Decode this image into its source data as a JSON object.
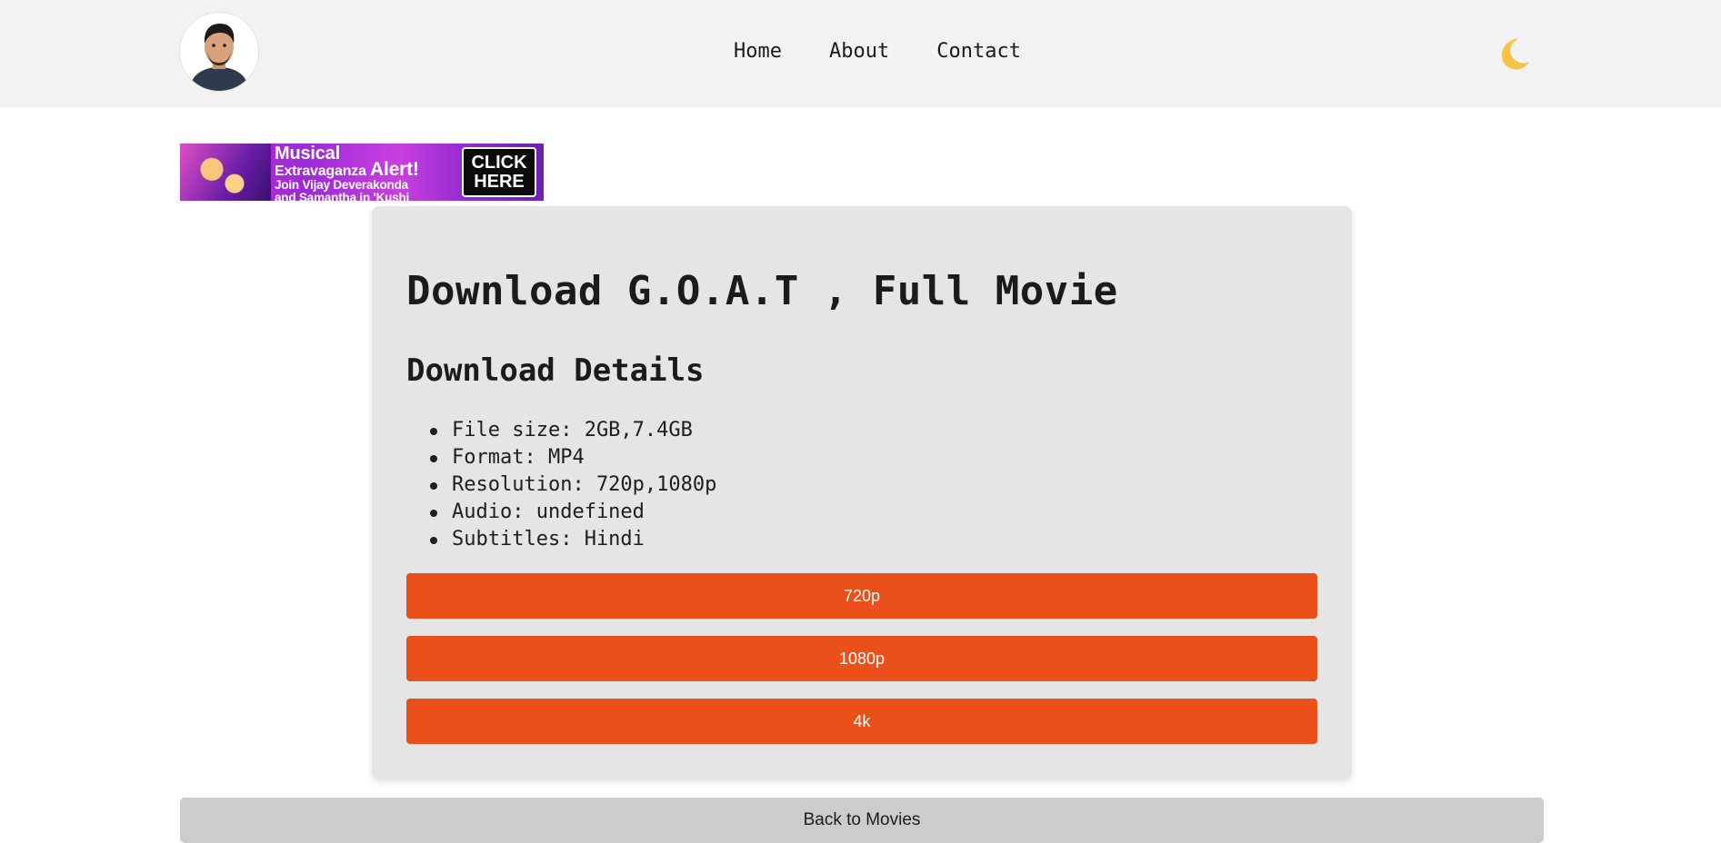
{
  "nav": {
    "links": [
      "Home",
      "About",
      "Contact"
    ],
    "theme_icon": "crescent-moon-icon"
  },
  "ad": {
    "line1a": "Musical",
    "line1b": "Extravaganza",
    "line1c": "Alert!",
    "line2": "Join Vijay Deverakonda",
    "line3": "and Samantha in 'Kushi",
    "cta_line1": "CLICK",
    "cta_line2": "HERE"
  },
  "main": {
    "title": "Download G.O.A.T , Full Movie",
    "section_title": "Download Details",
    "details": [
      "File size: 2GB,7.4GB",
      "Format: MP4",
      "Resolution: 720p,1080p",
      "Audio: undefined",
      "Subtitles: Hindi"
    ],
    "buttons": [
      "720p",
      "1080p",
      "4k"
    ],
    "back_label": "Back to Movies"
  },
  "colors": {
    "accent": "#ea5019",
    "navbar_bg": "#f2f2f2",
    "card_bg": "#e5e5e5",
    "back_button_bg": "#cccccc",
    "moon": "#f6c445"
  }
}
